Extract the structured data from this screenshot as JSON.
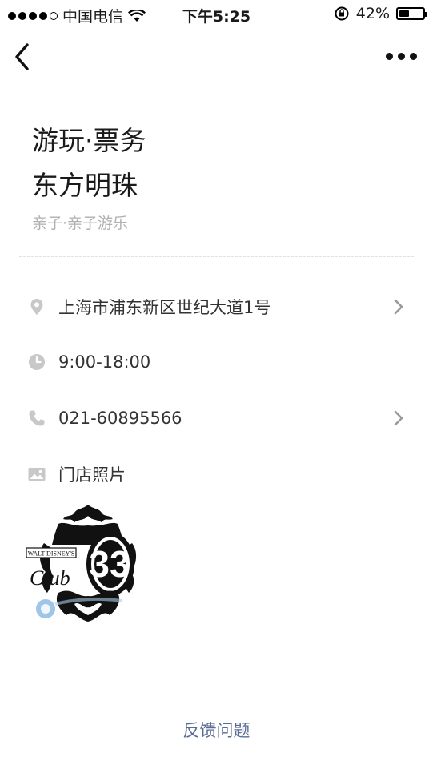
{
  "status_bar": {
    "carrier": "中国电信",
    "time": "下午5:25",
    "battery_percent": "42%",
    "battery_level": 0.42
  },
  "header": {
    "category": "游玩·票务",
    "store_name": "东方明珠",
    "subcategory": "亲子·亲子游乐"
  },
  "info": {
    "address": "上海市浦东新区世纪大道1号",
    "hours": "9:00-18:00",
    "phone": "021-60895566",
    "photos_label": "门店照片"
  },
  "photo": {
    "badge_number": "33",
    "text_club": "Club",
    "text_top": "WALT DISNEY'S"
  },
  "footer": {
    "feedback_label": "反馈问题"
  },
  "icons": {
    "back": "chevron-left-icon",
    "more": "more-dots-icon",
    "location": "location-pin-icon",
    "clock": "clock-icon",
    "phone": "phone-icon",
    "image": "image-icon",
    "chevron": "chevron-right-icon"
  },
  "colors": {
    "link": "#576b95",
    "muted": "#b0b0b0",
    "icon": "#c8c8c8"
  }
}
